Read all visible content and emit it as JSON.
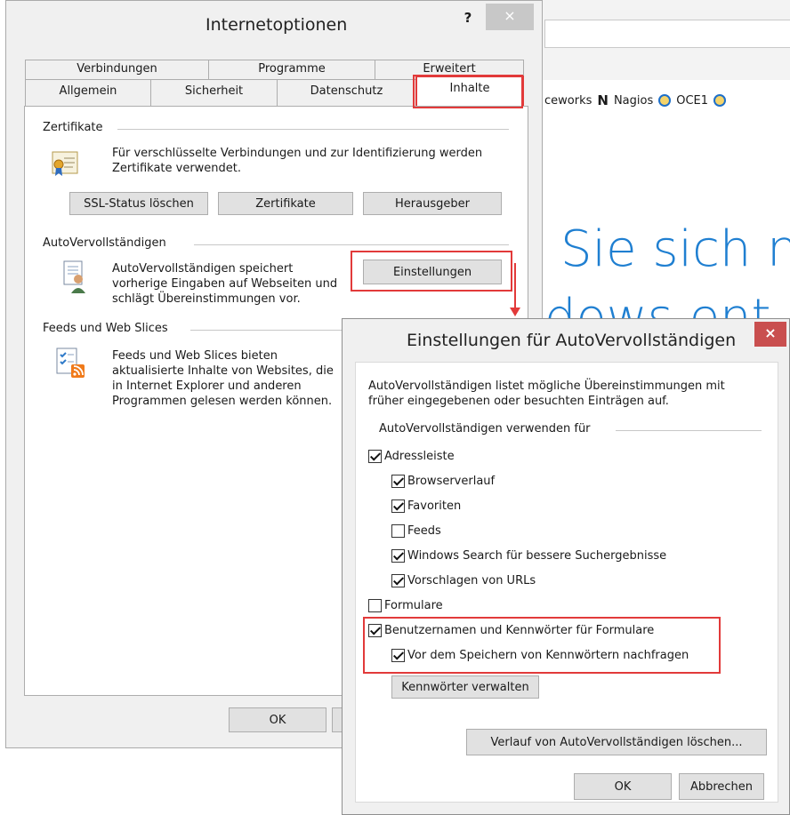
{
  "browser": {
    "favorites": [
      {
        "label": "ceworks",
        "icon": "none"
      },
      {
        "label": "Nagios",
        "icon": "nagios-icon"
      },
      {
        "label": "OCE1",
        "icon": "ie-icon"
      },
      {
        "label": "",
        "icon": "ie-icon"
      }
    ],
    "headline_line1": "Sie sich n",
    "headline_line2": "dows ent"
  },
  "main_dialog": {
    "title": "Internetoptionen",
    "help_label": "?",
    "close_label": "×",
    "tabs_row1": [
      "Verbindungen",
      "Programme",
      "Erweitert"
    ],
    "tabs_row2": [
      "Allgemein",
      "Sicherheit",
      "Datenschutz",
      "Inhalte"
    ],
    "certificates": {
      "label": "Zertifikate",
      "text": "Für verschlüsselte Verbindungen und zur Identifizierung werden Zertifikate verwendet.",
      "buttons": [
        "SSL-Status löschen",
        "Zertifikate",
        "Herausgeber"
      ]
    },
    "autocomplete": {
      "label": "AutoVervollständigen",
      "text": "AutoVervollständigen speichert vorherige Eingaben auf Webseiten und schlägt Übereinstimmungen vor.",
      "button": "Einstellungen"
    },
    "feeds": {
      "label": "Feeds und Web Slices",
      "text": "Feeds und Web Slices bieten aktualisierte Inhalte von Websites, die in Internet Explorer und anderen Programmen gelesen werden können."
    },
    "ok_label": "OK"
  },
  "settings_dialog": {
    "title": "Einstellungen für AutoVervollständigen",
    "close_label": "×",
    "intro": "AutoVervollständigen listet mögliche Übereinstimmungen mit früher eingegebenen oder besuchten Einträgen auf.",
    "group_label": "AutoVervollständigen verwenden für",
    "options": [
      {
        "label": "Adressleiste",
        "checked": true
      },
      {
        "label": "Browserverlauf",
        "checked": true
      },
      {
        "label": "Favoriten",
        "checked": true
      },
      {
        "label": "Feeds",
        "checked": false
      },
      {
        "label": "Windows Search für bessere Suchergebnisse",
        "checked": true
      },
      {
        "label": "Vorschlagen von URLs",
        "checked": true
      },
      {
        "label": "Formulare",
        "checked": false
      },
      {
        "label": "Benutzernamen und Kennwörter für Formulare",
        "checked": true
      },
      {
        "label": "Vor dem Speichern von Kennwörtern nachfragen",
        "checked": true
      }
    ],
    "manage_passwords": "Kennwörter verwalten",
    "clear_history": "Verlauf von AutoVervollständigen löschen...",
    "ok_label": "OK",
    "cancel_label": "Abbrechen"
  }
}
